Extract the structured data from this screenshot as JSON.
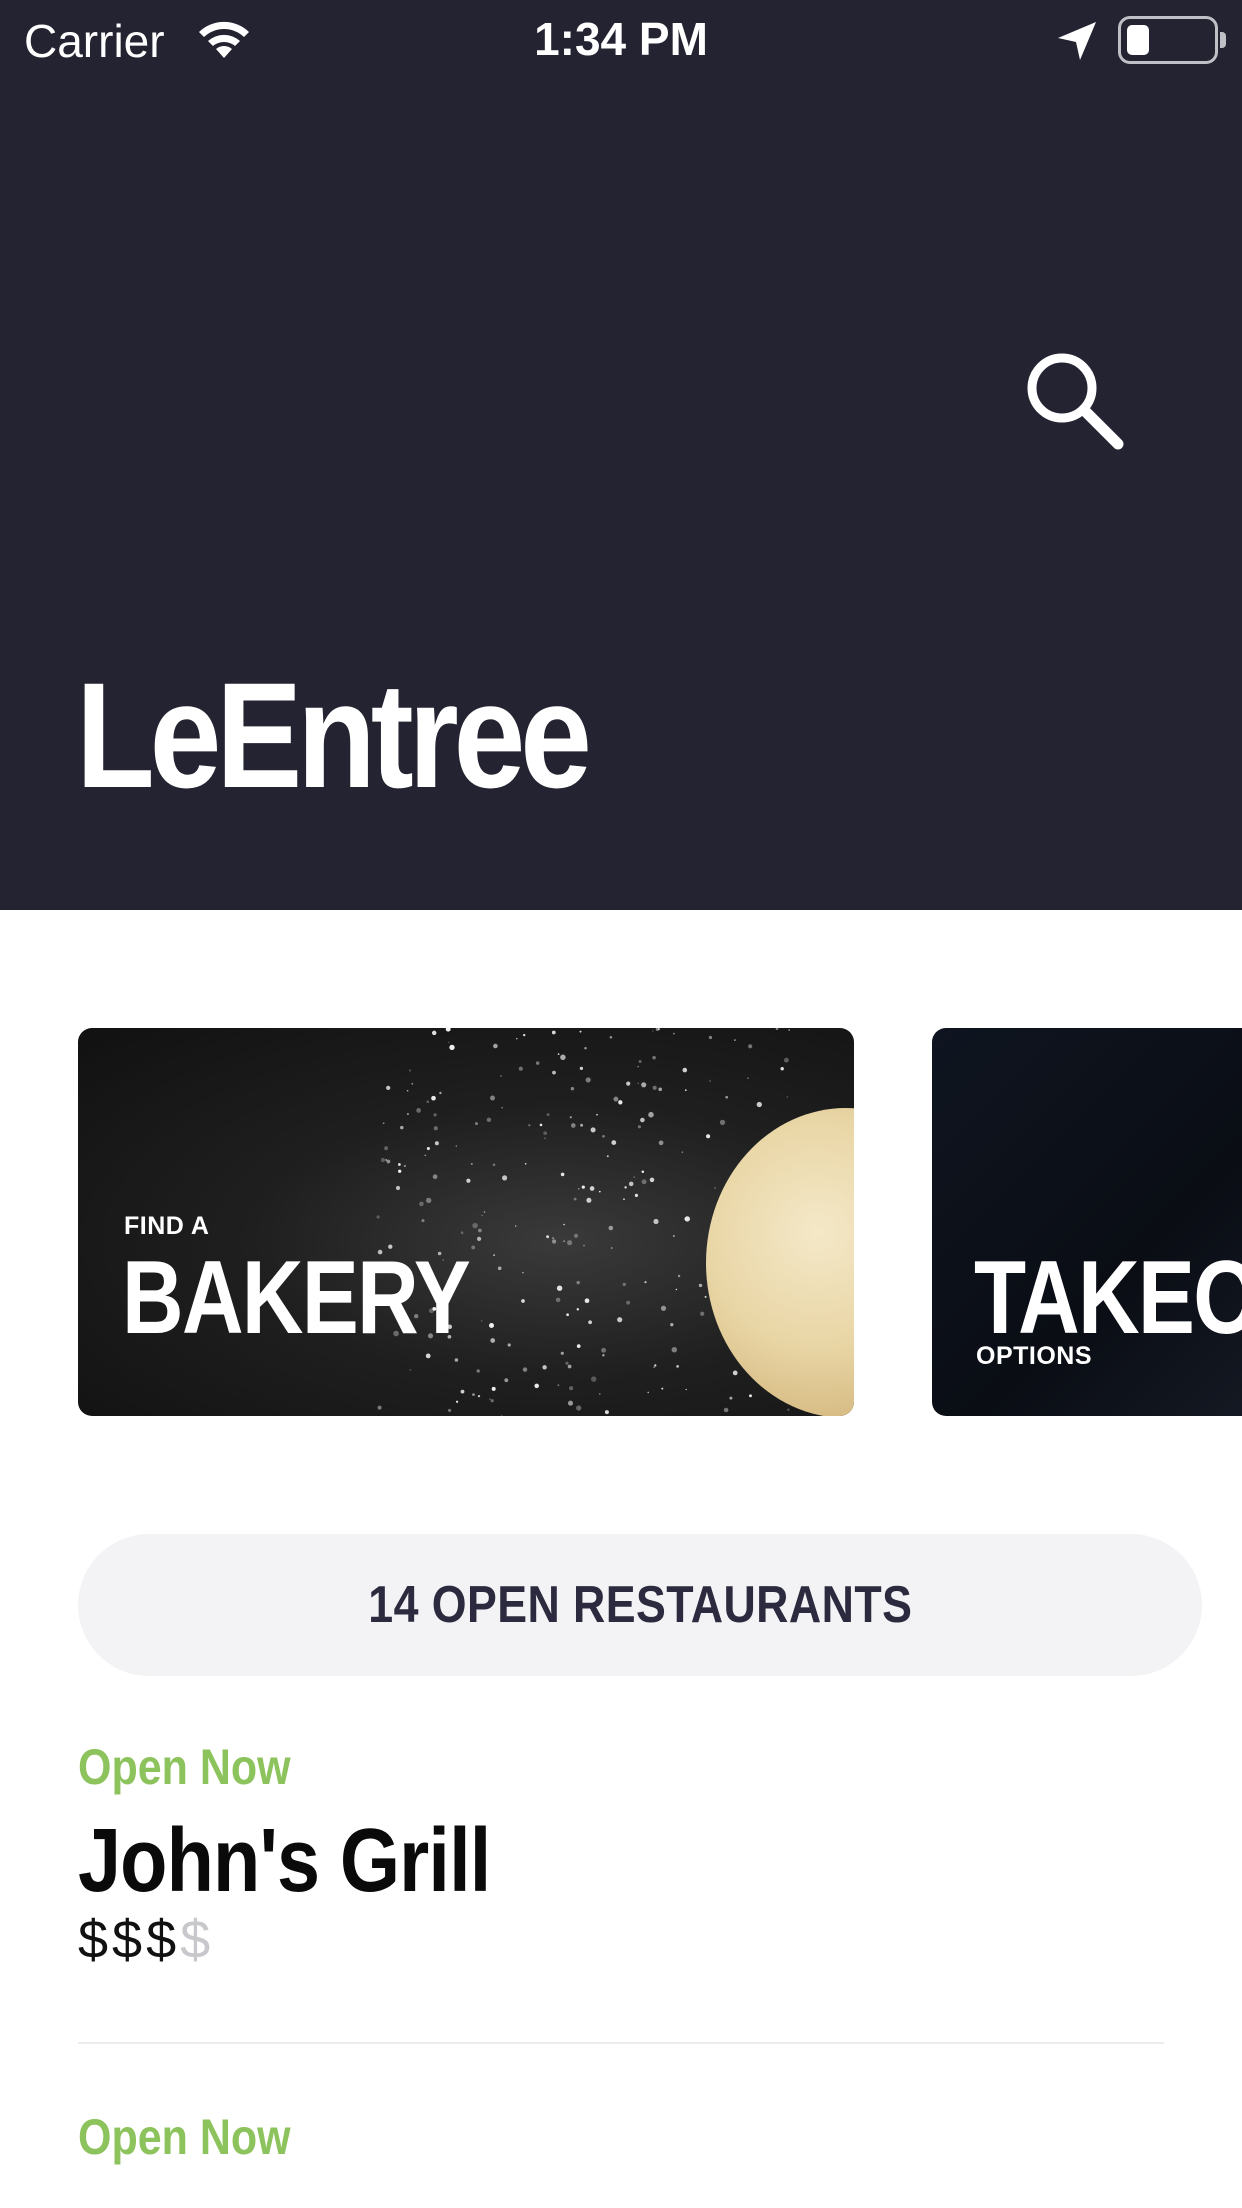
{
  "status_bar": {
    "carrier": "Carrier",
    "time": "1:34 PM",
    "battery_level": 0.25
  },
  "header": {
    "app_title": "LeEntree",
    "search_icon": "search-icon"
  },
  "carousel": {
    "cards": [
      {
        "small_label": "FIND A",
        "big_label": "BAKERY"
      },
      {
        "big_label": "TAKEOUT",
        "small_label": "OPTIONS"
      }
    ]
  },
  "open_restaurants_label": "14 OPEN RESTAURANTS",
  "restaurants": [
    {
      "status": "Open Now",
      "name": "John's Grill",
      "price_active": "$$$",
      "price_inactive": "$"
    },
    {
      "status": "Open Now"
    }
  ],
  "colors": {
    "header_bg": "#242331",
    "open_green": "#8cc35c",
    "pill_bg": "#f3f3f5",
    "pill_text": "#2b2a3e"
  }
}
